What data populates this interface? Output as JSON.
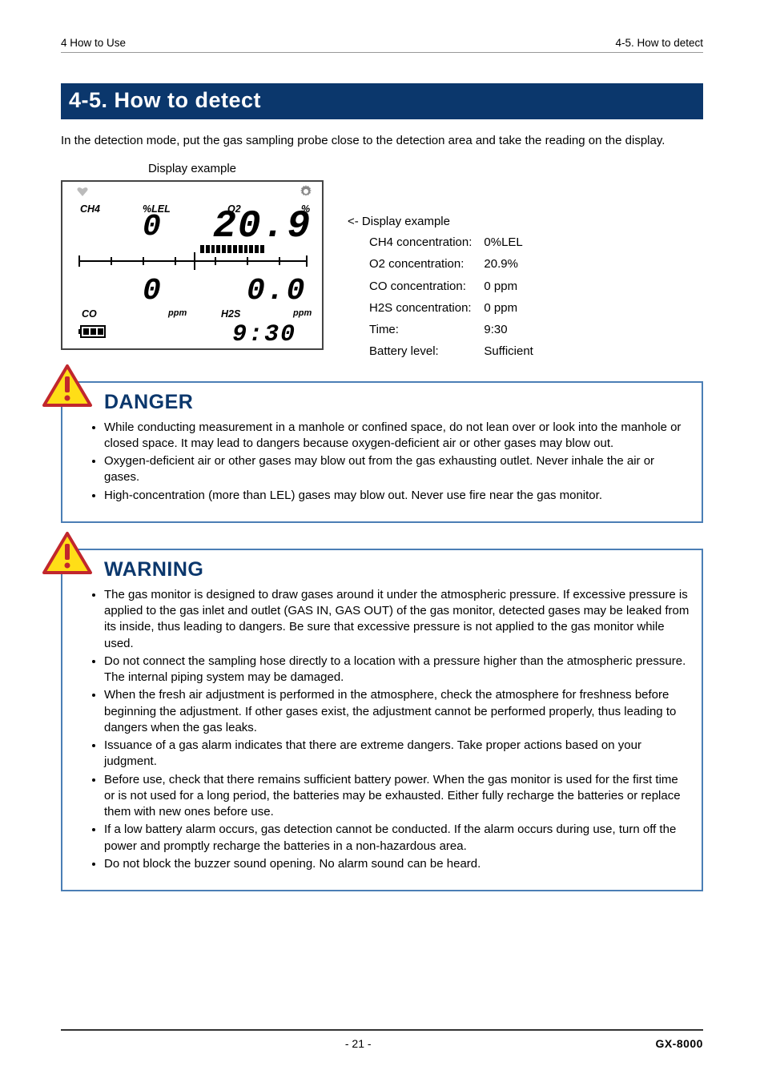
{
  "header": {
    "left": "4 How to Use",
    "right": "4-5. How to detect"
  },
  "section_title": "4-5. How to detect",
  "intro_text": "In the detection mode, put the gas sampling probe close to the detection area and take the reading on the display.",
  "display_caption": "Display example",
  "display_panel": {
    "ch4_label": "CH4",
    "lel_label": "%LEL",
    "o2_label": "O2",
    "pct_label": "%",
    "ch4_value": "0",
    "o2_value": "20.9",
    "co_label": "CO",
    "co_unit": "ppm",
    "h2s_label": "H2S",
    "h2s_unit": "ppm",
    "co_value": "0",
    "h2s_value": "0.0",
    "time_value": "9:30"
  },
  "legend": {
    "prefix": "<- Display example",
    "rows": [
      {
        "label": "CH4 concentration:",
        "value": "0%LEL"
      },
      {
        "label": "O2 concentration:",
        "value": "20.9%"
      },
      {
        "label": "CO concentration:",
        "value": "0 ppm"
      },
      {
        "label": "H2S concentration:",
        "value": "0 ppm"
      },
      {
        "label": "Time:",
        "value": "9:30"
      },
      {
        "label": "Battery level:",
        "value": "Sufficient"
      }
    ]
  },
  "danger": {
    "title": "DANGER",
    "items": [
      "While conducting measurement in a manhole or confined space, do not lean over or look into the manhole or closed space. It may lead to dangers because oxygen-deficient air or other gases may blow out.",
      "Oxygen-deficient air or other gases may blow out from the gas exhausting outlet. Never inhale the air or gases.",
      "High-concentration (more than LEL) gases may blow out. Never use fire near the gas monitor."
    ]
  },
  "warning": {
    "title": "WARNING",
    "items": [
      "The gas monitor is designed to draw gases around it under the atmospheric pressure. If excessive pressure is applied to the gas inlet and outlet (GAS IN, GAS OUT) of the gas monitor, detected gases may be leaked from its inside, thus leading to dangers. Be sure that excessive pressure is not applied to the gas monitor while used.",
      "Do not connect the sampling hose directly to a location with a pressure higher than the atmospheric pressure. The internal piping system may be damaged.",
      "When the fresh air adjustment is performed in the atmosphere, check the atmosphere for freshness before beginning the adjustment. If other gases exist, the adjustment cannot be performed properly, thus leading to dangers when the gas leaks.",
      "Issuance of a gas alarm indicates that there are extreme dangers. Take proper actions based on your judgment.",
      "Before use, check that there remains sufficient battery power. When the gas monitor is used for the first time or is not used for a long period, the batteries may be exhausted. Either fully recharge the batteries or replace them with new ones before use.",
      "If a low battery alarm occurs, gas detection cannot be conducted. If the alarm occurs during use, turn off the power and promptly recharge the batteries in a non-hazardous area.",
      "Do not block the buzzer sound opening. No alarm sound can be heard."
    ]
  },
  "footer": {
    "page": "- 21 -",
    "model": "GX-8000"
  }
}
